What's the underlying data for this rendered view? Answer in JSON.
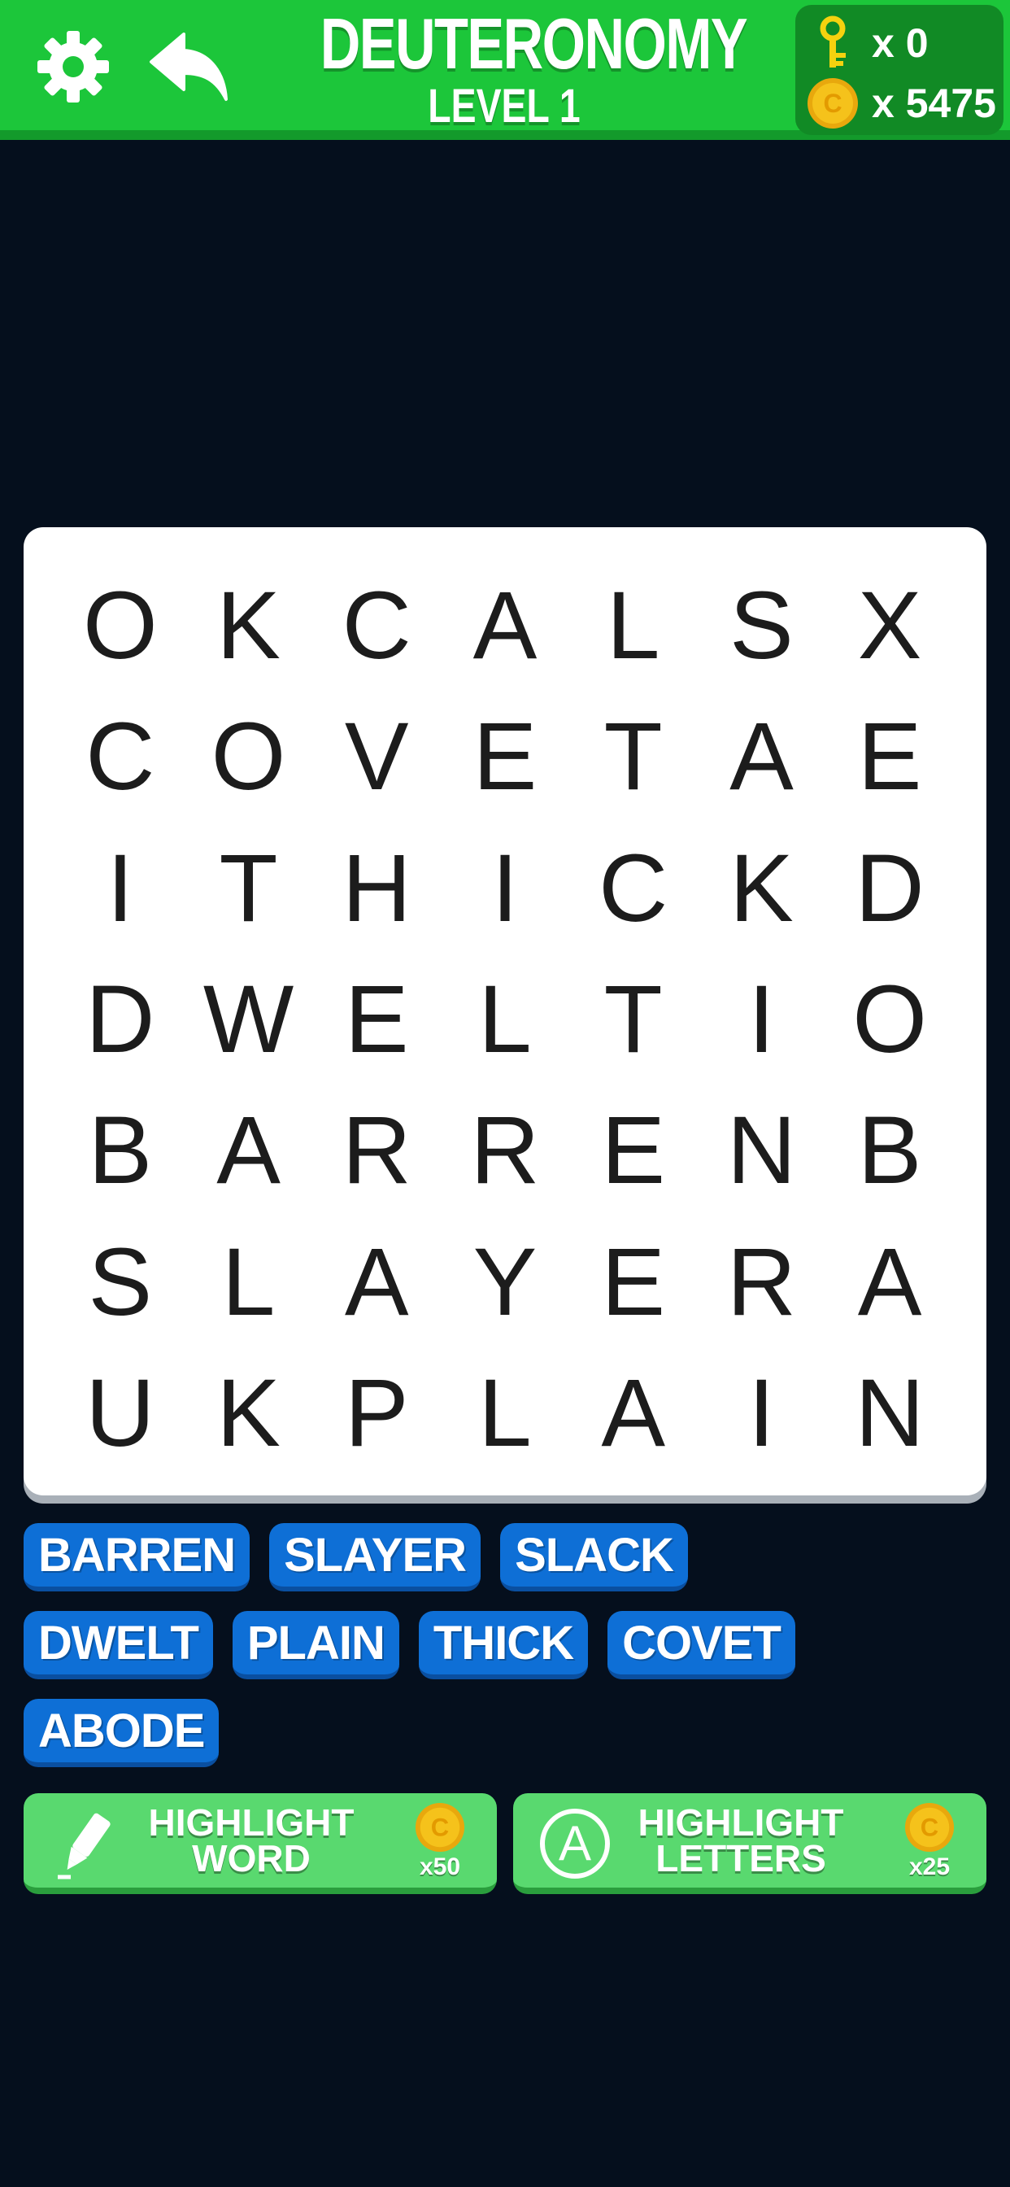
{
  "header": {
    "title": "DEUTERONOMY",
    "subtitle": "LEVEL 1",
    "keys": "x 0",
    "coins": "x 5475"
  },
  "grid": [
    [
      "O",
      "K",
      "C",
      "A",
      "L",
      "S",
      "X"
    ],
    [
      "C",
      "O",
      "V",
      "E",
      "T",
      "A",
      "E"
    ],
    [
      "I",
      "T",
      "H",
      "I",
      "C",
      "K",
      "D"
    ],
    [
      "D",
      "W",
      "E",
      "L",
      "T",
      "I",
      "O"
    ],
    [
      "B",
      "A",
      "R",
      "R",
      "E",
      "N",
      "B"
    ],
    [
      "S",
      "L",
      "A",
      "Y",
      "E",
      "R",
      "A"
    ],
    [
      "U",
      "K",
      "P",
      "L",
      "A",
      "I",
      "N"
    ]
  ],
  "words": [
    [
      "BARREN",
      "SLAYER",
      "SLACK"
    ],
    [
      "DWELT",
      "PLAIN",
      "THICK",
      "COVET"
    ],
    [
      "ABODE"
    ]
  ],
  "powerups": {
    "highlight_word": {
      "line1": "HIGHLIGHT",
      "line2": "WORD",
      "cost": "x50"
    },
    "highlight_letters": {
      "line1": "HIGHLIGHT",
      "line2": "LETTERS",
      "cost": "x25"
    }
  },
  "colors": {
    "header_green": "#1cc63a",
    "background": "#050f1d",
    "chip_blue": "#0e6fd6",
    "powerup_green": "#59d96f",
    "coin_gold": "#f5c21b"
  },
  "icons": {
    "settings": "gear-icon",
    "back": "undo-arrow-icon",
    "key": "key-icon",
    "coin": "coin-icon",
    "pencil": "highlighter-icon",
    "letter": "letter-a-icon"
  }
}
